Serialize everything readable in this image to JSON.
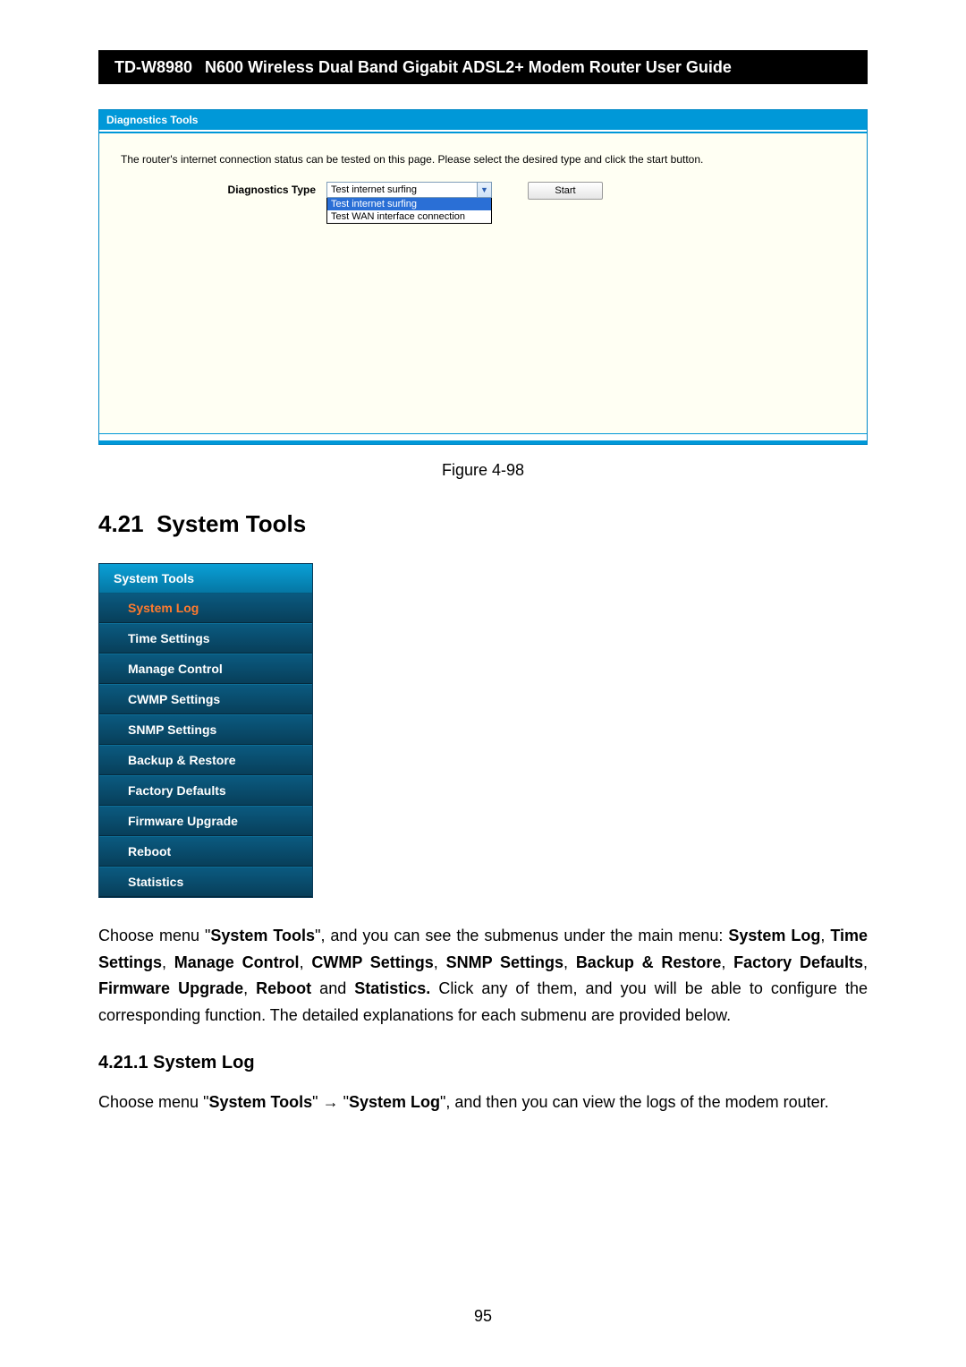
{
  "header": {
    "model": "TD-W8980",
    "subtitle": "N600 Wireless Dual Band Gigabit ADSL2+ Modem Router User Guide"
  },
  "figure": {
    "panel_title": "Diagnostics Tools",
    "desc": "The router's internet connection status can be tested on this page. Please select the desired type and click the start button.",
    "label": "Diagnostics Type",
    "selected": "Test internet surfing",
    "options": [
      "Test internet surfing",
      "Test WAN interface connection"
    ],
    "start": "Start",
    "caption": "Figure 4-98"
  },
  "section": {
    "number": "4.21",
    "title": "System Tools"
  },
  "menu": {
    "head": "System Tools",
    "items": [
      "System Log",
      "Time Settings",
      "Manage Control",
      "CWMP Settings",
      "SNMP Settings",
      "Backup & Restore",
      "Factory Defaults",
      "Firmware Upgrade",
      "Reboot",
      "Statistics"
    ],
    "active_index": 0
  },
  "paragraph1": {
    "pre": "Choose menu \"",
    "b1": "System Tools",
    "mid1": "\", and you can see the submenus under the main menu: ",
    "b2": "System Log",
    "c1": ", ",
    "b3": "Time Settings",
    "c2": ", ",
    "b4": "Manage Control",
    "c3": ", ",
    "b5": "CWMP Settings",
    "c4": ", ",
    "b6": "SNMP Settings",
    "c5": ", ",
    "b7": "Backup & Restore",
    "c6": ", ",
    "b8": "Factory Defaults",
    "c7": ", ",
    "b9": "Firmware Upgrade",
    "c8": ", ",
    "b10": "Reboot",
    "c9": " and ",
    "b11": "Statistics.",
    "tail": " Click any of them, and you will be able to configure the corresponding function. The detailed explanations for each submenu are provided below."
  },
  "subsection": {
    "number": "4.21.1",
    "title": "System Log"
  },
  "paragraph2": {
    "pre": "Choose menu \"",
    "b1": "System Tools",
    "mid1": "\"  →  \"",
    "b2": "System Log",
    "tail": "\", and then you can view the logs of the modem router."
  },
  "page_number": "95"
}
